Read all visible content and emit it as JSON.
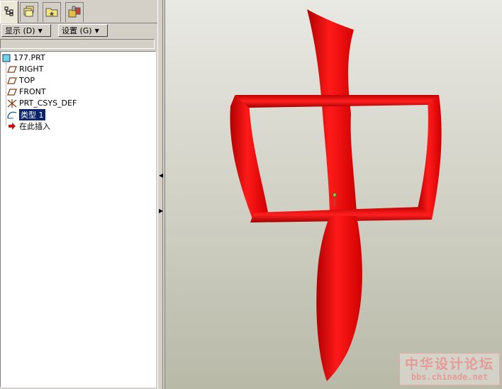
{
  "tabs": [
    {
      "icon": "model-tree-icon"
    },
    {
      "icon": "folder-browser-icon"
    },
    {
      "icon": "favorites-folder-icon"
    },
    {
      "icon": "connections-icon"
    }
  ],
  "toolbar": {
    "show_label": "显示 (D)",
    "settings_label": "设置 (G)"
  },
  "tree": {
    "root": "177.PRT",
    "items": [
      {
        "label": "RIGHT",
        "icon": "datum-plane-icon"
      },
      {
        "label": "TOP",
        "icon": "datum-plane-icon"
      },
      {
        "label": "FRONT",
        "icon": "datum-plane-icon"
      },
      {
        "label": "PRT_CSYS_DEF",
        "icon": "csys-icon"
      },
      {
        "label": "类型 1",
        "icon": "feature-icon",
        "selected": true
      },
      {
        "label": "在此插入",
        "icon": "insert-here-arrow-icon"
      }
    ]
  },
  "watermark": {
    "title": "中华设计论坛",
    "url": "bbs.chinade.net"
  },
  "colors": {
    "model": "#ee1111",
    "selection": "#0a246a",
    "watermark": "#e79a9a"
  }
}
